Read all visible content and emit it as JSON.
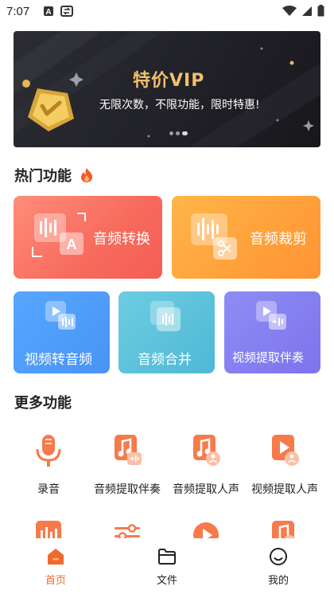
{
  "status": {
    "time": "7:07"
  },
  "banner": {
    "title": "特价VIP",
    "subtitle": "无限次数，不限功能，限时特惠!"
  },
  "hot": {
    "title": "热门功能",
    "cards": [
      {
        "label": "音频转换",
        "icon": "audio-convert-icon"
      },
      {
        "label": "音频裁剪",
        "icon": "audio-cut-icon"
      },
      {
        "label": "视频转音频",
        "icon": "video-to-audio-icon"
      },
      {
        "label": "音频合并",
        "icon": "audio-merge-icon"
      },
      {
        "label": "视频提取伴奏",
        "icon": "video-extract-accompaniment-icon"
      }
    ]
  },
  "more": {
    "title": "更多功能",
    "items": [
      {
        "label": "录音",
        "icon": "microphone-icon"
      },
      {
        "label": "音频提取伴奏",
        "icon": "audio-extract-accompaniment-icon"
      },
      {
        "label": "音频提取人声",
        "icon": "audio-extract-vocal-icon"
      },
      {
        "label": "视频提取人声",
        "icon": "video-extract-vocal-icon"
      }
    ]
  },
  "nav": {
    "items": [
      {
        "label": "首页",
        "icon": "home-icon",
        "active": true
      },
      {
        "label": "文件",
        "icon": "folder-icon",
        "active": false
      },
      {
        "label": "我的",
        "icon": "profile-icon",
        "active": false
      }
    ]
  },
  "colors": {
    "accent": "#f06a2c",
    "banner_gold": "#f1c06c"
  }
}
